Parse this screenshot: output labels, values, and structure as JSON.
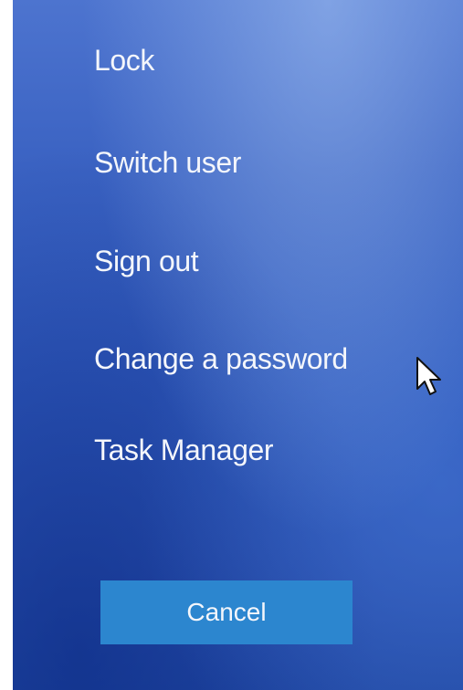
{
  "menu": {
    "items": [
      {
        "label": "Lock"
      },
      {
        "label": "Switch user"
      },
      {
        "label": "Sign out"
      },
      {
        "label": "Change a password"
      },
      {
        "label": "Task Manager"
      }
    ]
  },
  "cancel": {
    "label": "Cancel"
  },
  "colors": {
    "background": "#3560c0",
    "button": "#2c86cf",
    "text": "#f4f6fb"
  },
  "icons": {
    "pointer": "mouse-pointer-icon"
  }
}
